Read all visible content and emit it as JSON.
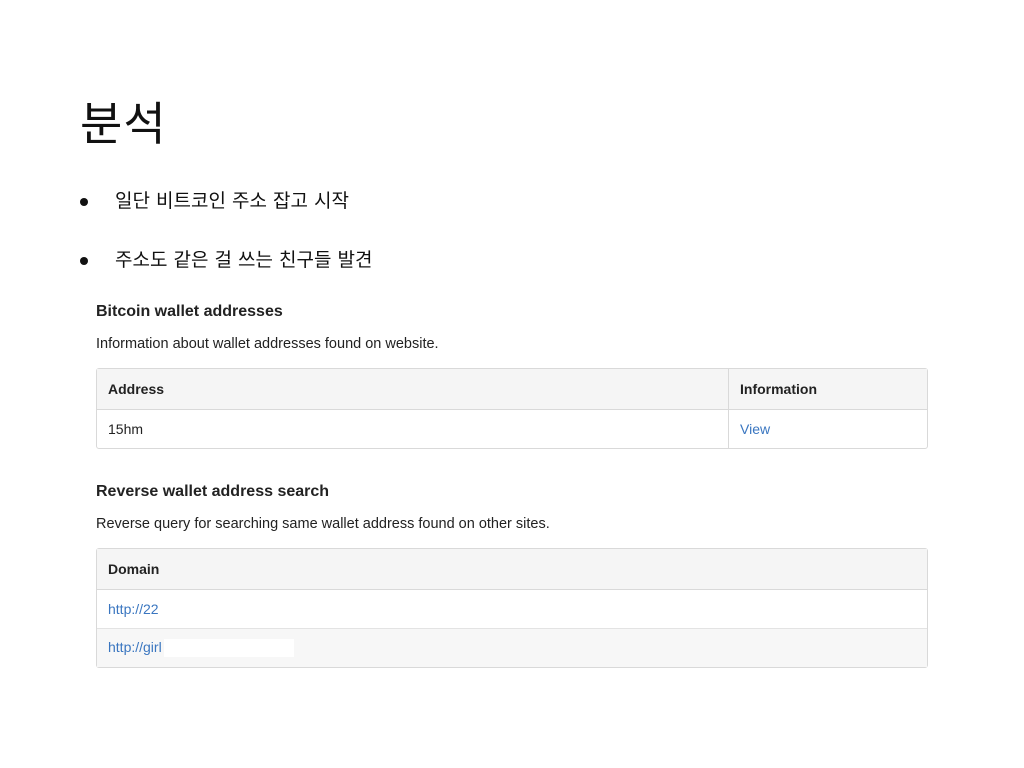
{
  "slide": {
    "title": "분석",
    "bullets": [
      "일단 비트코인 주소 잡고 시작",
      "주소도 같은 걸 쓰는 친구들 발견"
    ]
  },
  "wallet_section": {
    "heading": "Bitcoin wallet addresses",
    "description": "Information about wallet addresses found on website.",
    "columns": [
      "Address",
      "Information"
    ],
    "rows": [
      {
        "address": "15hm",
        "info_link": "View"
      }
    ]
  },
  "reverse_section": {
    "heading": "Reverse wallet address search",
    "description": "Reverse query for searching same wallet address found on other sites.",
    "columns": [
      "Domain"
    ],
    "rows": [
      {
        "domain": "http://22"
      },
      {
        "domain": "http://girl"
      }
    ]
  },
  "colors": {
    "link": "#3a76c0",
    "header_bg": "#f5f5f5",
    "border": "#d9d9d9"
  }
}
